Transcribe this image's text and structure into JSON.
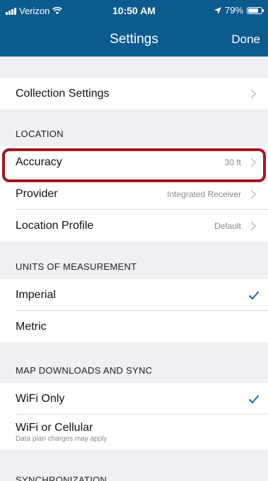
{
  "status": {
    "carrier": "Verizon",
    "time": "10:50 AM",
    "battery": "79%",
    "battery_level": 0.79
  },
  "nav": {
    "title": "Settings",
    "done_label": "Done"
  },
  "sections": {
    "collection": {
      "label": "Collection Settings"
    },
    "location": {
      "header": "LOCATION",
      "accuracy": {
        "label": "Accuracy",
        "value": "30 ft"
      },
      "provider": {
        "label": "Provider",
        "value": "Integrated Receiver"
      },
      "profile": {
        "label": "Location Profile",
        "value": "Default"
      }
    },
    "units": {
      "header": "UNITS OF MEASUREMENT",
      "imperial": {
        "label": "Imperial",
        "selected": true
      },
      "metric": {
        "label": "Metric",
        "selected": false
      }
    },
    "downloads": {
      "header": "MAP DOWNLOADS AND SYNC",
      "wifi": {
        "label": "WiFi Only",
        "selected": true
      },
      "cellular": {
        "label": "WiFi or Cellular",
        "sub": "Data plan charges may apply",
        "selected": false
      }
    },
    "sync": {
      "header": "SYNCHRONIZATION"
    }
  },
  "colors": {
    "nav_bg": "#0c5b8e",
    "accent": "#1a6fa6",
    "highlight": "#a51620"
  }
}
